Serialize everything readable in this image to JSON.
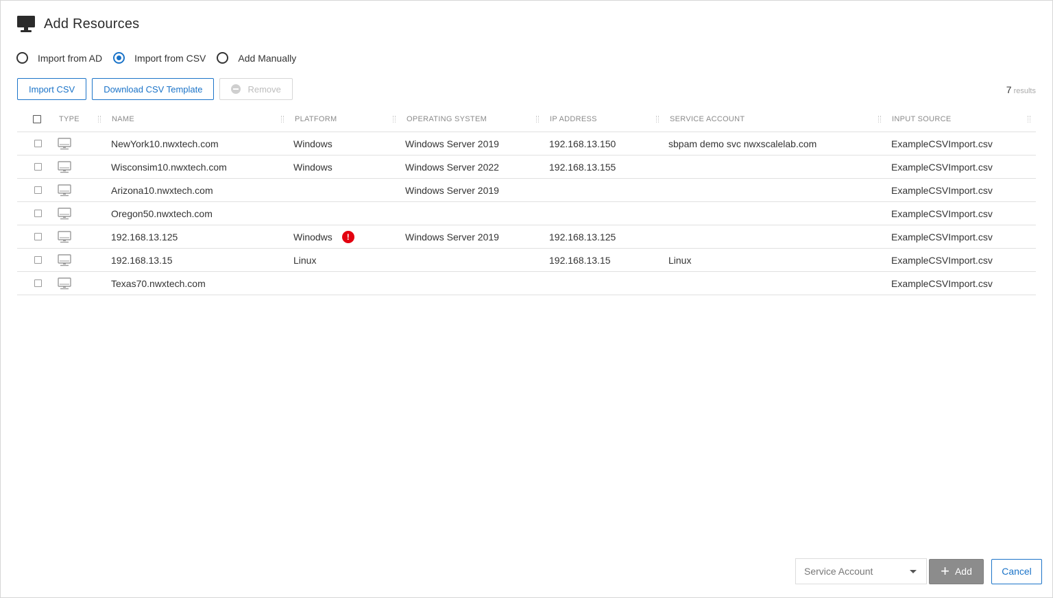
{
  "header": {
    "title": "Add Resources",
    "icon": "monitor-icon"
  },
  "import_mode": {
    "options": [
      {
        "label": "Import from AD",
        "selected": false
      },
      {
        "label": "Import from CSV",
        "selected": true
      },
      {
        "label": "Add Manually",
        "selected": false
      }
    ]
  },
  "toolbar": {
    "import_csv": "Import CSV",
    "download_template": "Download CSV Template",
    "remove": "Remove"
  },
  "results": {
    "count": "7",
    "label": "results"
  },
  "table": {
    "columns": {
      "type": "TYPE",
      "name": "NAME",
      "platform": "PLATFORM",
      "os": "OPERATING SYSTEM",
      "ip": "IP ADDRESS",
      "service_account": "SERVICE ACCOUNT",
      "input_source": "INPUT SOURCE"
    },
    "rows": [
      {
        "name": "NewYork10.nwxtech.com",
        "platform": "Windows",
        "os": "Windows Server 2019",
        "ip": "192.168.13.150",
        "service_account": "sbpam demo svc nwxscalelab.com",
        "input_source": "ExampleCSVImport.csv",
        "warning": false
      },
      {
        "name": "Wisconsim10.nwxtech.com",
        "platform": "Windows",
        "os": "Windows Server 2022",
        "ip": "192.168.13.155",
        "service_account": "",
        "input_source": "ExampleCSVImport.csv",
        "warning": false
      },
      {
        "name": "Arizona10.nwxtech.com",
        "platform": "",
        "os": "Windows Server 2019",
        "ip": "",
        "service_account": "",
        "input_source": "ExampleCSVImport.csv",
        "warning": false
      },
      {
        "name": "Oregon50.nwxtech.com",
        "platform": "",
        "os": "",
        "ip": "",
        "service_account": "",
        "input_source": "ExampleCSVImport.csv",
        "warning": false
      },
      {
        "name": "192.168.13.125",
        "platform": "Winodws",
        "os": "Windows Server 2019",
        "ip": "192.168.13.125",
        "service_account": "",
        "input_source": "ExampleCSVImport.csv",
        "warning": true
      },
      {
        "name": "192.168.13.15",
        "platform": "Linux",
        "os": "",
        "ip": "192.168.13.15",
        "service_account": "Linux",
        "input_source": "ExampleCSVImport.csv",
        "warning": false
      },
      {
        "name": "Texas70.nwxtech.com",
        "platform": "",
        "os": "",
        "ip": "",
        "service_account": "",
        "input_source": "ExampleCSVImport.csv",
        "warning": false
      }
    ]
  },
  "footer": {
    "service_account_placeholder": "Service Account",
    "add": "Add",
    "cancel": "Cancel"
  },
  "colors": {
    "accent": "#1a73c8",
    "error": "#e3000f",
    "add_button": "#8c8c8c"
  }
}
